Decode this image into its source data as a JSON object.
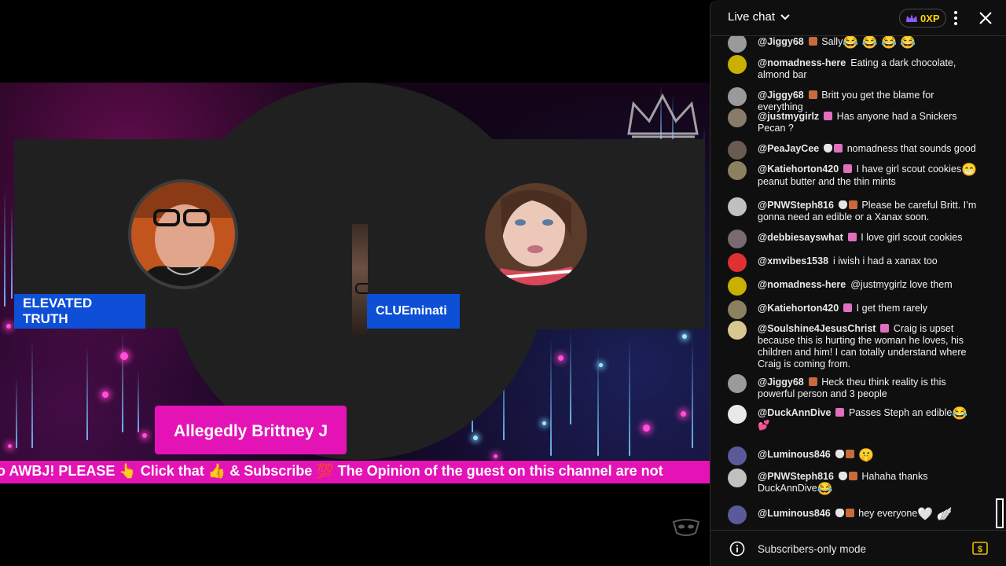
{
  "stage": {
    "left_name": "ELEVATED TRUTH",
    "right_name": "CLUEminati",
    "guest_banner": "Allegedly Brittney J",
    "ticker": "o AWBJ! PLEASE 👆 Click that 👍 & Subscribe 💯 The Opinion of the guest on this channel are not"
  },
  "chat": {
    "header": {
      "title": "Live chat",
      "xp": "0XP"
    },
    "messages": [
      {
        "author": "@Jiggy68",
        "badges": [
          "member"
        ],
        "text": "Sally",
        "emojis": "😂 😂 😂 😂",
        "avatar_color": "#9a9a9a"
      },
      {
        "author": "@nomadness-here",
        "badges": [],
        "text": "Eating a dark chocolate, almond bar",
        "emojis": "",
        "avatar_color": "#c9b000"
      },
      {
        "author": "@Jiggy68",
        "badges": [
          "member"
        ],
        "text": "Britt you get the blame for everything",
        "emojis": "",
        "avatar_color": "#9a9a9a"
      },
      {
        "author": "@justmygirlz",
        "badges": [
          "pink"
        ],
        "text": "Has anyone had a Snickers Pecan ?",
        "emojis": "",
        "avatar_color": "#8a7a6a"
      },
      {
        "author": "@PeaJayCee",
        "badges": [
          "mod",
          "pink"
        ],
        "text": "nomadness that sounds good",
        "emojis": "",
        "avatar_color": "#6b5a50"
      },
      {
        "author": "@Katiehorton420",
        "badges": [
          "pink"
        ],
        "text": "I have girl scout cookies",
        "emojis": "😁",
        "text2": "peanut butter and the thin mints",
        "avatar_color": "#8c8060"
      },
      {
        "author": "@PNWSteph816",
        "badges": [
          "mod",
          "member"
        ],
        "text": "Please be careful Britt. I’m gonna need an edible or a Xanax soon.",
        "emojis": "",
        "avatar_color": "#c0c0c0"
      },
      {
        "author": "@debbiesayswhat",
        "badges": [
          "pink"
        ],
        "text": "I love girl scout cookies",
        "emojis": "",
        "avatar_color": "#7a6a70"
      },
      {
        "author": "@xmvibes1538",
        "badges": [],
        "text": "i iwish i had a xanax too",
        "emojis": "",
        "avatar_color": "#e03030"
      },
      {
        "author": "@nomadness-here",
        "badges": [],
        "text": "@justmygirlz love them",
        "emojis": "",
        "avatar_color": "#c9b000"
      },
      {
        "author": "@Katiehorton420",
        "badges": [
          "pink"
        ],
        "text": "I get them rarely",
        "emojis": "",
        "avatar_color": "#8c8060"
      },
      {
        "author": "@Soulshine4JesusChrist",
        "badges": [
          "pink"
        ],
        "text": "Craig is upset because this is hurting the woman he loves, his children and him! I can totally understand where Craig is coming from.",
        "emojis": "",
        "avatar_color": "#d8c890"
      },
      {
        "author": "@Jiggy68",
        "badges": [
          "member"
        ],
        "text": "Heck theu think reality is this powerful person and 3 people",
        "emojis": "",
        "avatar_color": "#9a9a9a"
      },
      {
        "author": "@DuckAnnDive",
        "badges": [
          "pink"
        ],
        "text": "Passes Steph an edible",
        "emojis": "😂",
        "text2": "💕",
        "avatar_color": "#e8e8e8"
      },
      {
        "author": "@Luminous846",
        "badges": [
          "mod",
          "member"
        ],
        "text": "",
        "emojis": "🤫",
        "avatar_color": "#5a5a9a"
      },
      {
        "author": "@PNWSteph816",
        "badges": [
          "mod",
          "member"
        ],
        "text": "Hahaha thanks DuckAnnDive",
        "emojis": "😂",
        "avatar_color": "#c0c0c0"
      },
      {
        "author": "@Luminous846",
        "badges": [
          "mod",
          "member"
        ],
        "text": "hey everyone",
        "emojis": "🤍 🪽",
        "avatar_color": "#5a5a9a"
      }
    ],
    "footer": {
      "mode": "Subscribers-only mode"
    }
  },
  "icons": [
    "crown-outline-icon",
    "chevron-down-icon",
    "crown-icon",
    "more-vert-icon",
    "close-icon",
    "info-icon",
    "dollar-icon"
  ]
}
